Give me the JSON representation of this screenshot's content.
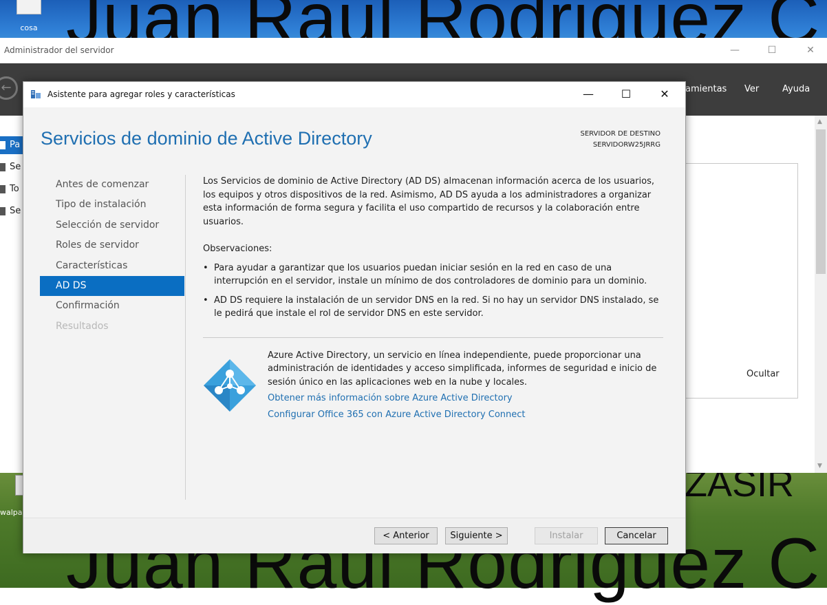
{
  "desktop": {
    "bg_text_top": "Juan Raul Rodriguez C",
    "bg_text_bottom": "Juan Raul Rodriguez C",
    "bg_text_mid": "ZASIR",
    "icons": [
      {
        "label": "cosa"
      },
      {
        "label": "walpap"
      }
    ]
  },
  "server_manager": {
    "title": "Administrador del servidor",
    "menu": [
      "amientas",
      "Ver",
      "Ayuda"
    ],
    "nav_items": [
      {
        "label": "Pa",
        "active": true
      },
      {
        "label": "Se"
      },
      {
        "label": "To"
      },
      {
        "label": "Se"
      }
    ],
    "hide_label": "Ocultar"
  },
  "wizard": {
    "title": "Asistente para agregar roles y características",
    "heading": "Servicios de dominio de Active Directory",
    "destination_label": "SERVIDOR DE DESTINO",
    "destination_server": "SERVIDORW25JRRG",
    "steps": [
      {
        "label": "Antes de comenzar",
        "state": "normal"
      },
      {
        "label": "Tipo de instalación",
        "state": "normal"
      },
      {
        "label": "Selección de servidor",
        "state": "normal"
      },
      {
        "label": "Roles de servidor",
        "state": "normal"
      },
      {
        "label": "Características",
        "state": "normal"
      },
      {
        "label": "AD DS",
        "state": "active"
      },
      {
        "label": "Confirmación",
        "state": "normal"
      },
      {
        "label": "Resultados",
        "state": "disabled"
      }
    ],
    "intro": "Los Servicios de dominio de Active Directory (AD DS) almacenan información acerca de los usuarios, los equipos y otros dispositivos de la red. Asimismo, AD DS ayuda a los administradores a organizar esta información de forma segura y facilita el uso compartido de recursos y la colaboración entre usuarios.",
    "observations_title": "Observaciones:",
    "observations": [
      "Para ayudar a garantizar que los usuarios puedan iniciar sesión en la red en caso de una interrupción en el servidor, instale un mínimo de dos controladores de dominio para un dominio.",
      "AD DS requiere la instalación de un servidor DNS en la red. Si no hay un servidor DNS instalado, se le pedirá que instale el rol de servidor DNS en este servidor."
    ],
    "azure_text": "Azure Active Directory, un servicio en línea independiente, puede proporcionar una administración de identidades y acceso simplificada, informes de seguridad e inicio de sesión único en las aplicaciones web en la nube y locales.",
    "azure_links": [
      "Obtener más información sobre Azure Active Directory",
      "Configurar Office 365 con Azure Active Directory Connect"
    ],
    "buttons": {
      "previous": "< Anterior",
      "next": "Siguiente >",
      "install": "Instalar",
      "cancel": "Cancelar"
    },
    "accent_color": "#0a6ec2"
  }
}
